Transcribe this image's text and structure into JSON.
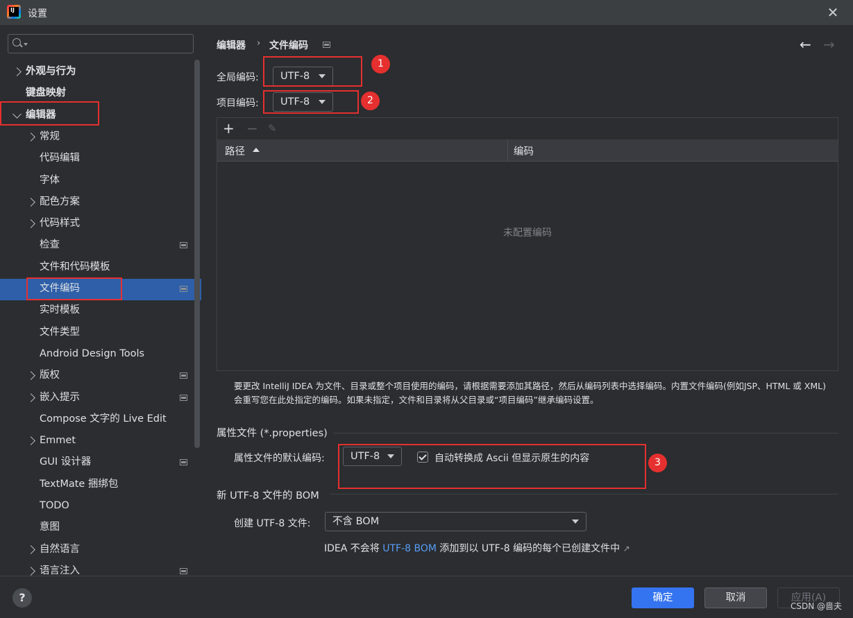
{
  "window": {
    "title": "设置"
  },
  "sidebar": {
    "items": [
      {
        "label": "外观与行为",
        "chevron": "right",
        "bold": true
      },
      {
        "label": "键盘映射",
        "chevron": "none",
        "bold": true
      },
      {
        "label": "编辑器",
        "chevron": "down",
        "bold": true
      },
      {
        "label": "常规",
        "chevron": "right"
      },
      {
        "label": "代码编辑",
        "chevron": "none"
      },
      {
        "label": "字体",
        "chevron": "none"
      },
      {
        "label": "配色方案",
        "chevron": "right"
      },
      {
        "label": "代码样式",
        "chevron": "right"
      },
      {
        "label": "检查",
        "chevron": "none",
        "project_icon": true
      },
      {
        "label": "文件和代码模板",
        "chevron": "none"
      },
      {
        "label": "文件编码",
        "chevron": "none",
        "project_icon": true,
        "selected": true
      },
      {
        "label": "实时模板",
        "chevron": "none"
      },
      {
        "label": "文件类型",
        "chevron": "none"
      },
      {
        "label": "Android Design Tools",
        "chevron": "none"
      },
      {
        "label": "版权",
        "chevron": "right",
        "project_icon": true
      },
      {
        "label": "嵌入提示",
        "chevron": "right",
        "project_icon": true
      },
      {
        "label": "Compose 文字的 Live Edit",
        "chevron": "none"
      },
      {
        "label": "Emmet",
        "chevron": "right"
      },
      {
        "label": "GUI 设计器",
        "chevron": "none",
        "project_icon": true
      },
      {
        "label": "TextMate 捆绑包",
        "chevron": "none"
      },
      {
        "label": "TODO",
        "chevron": "none"
      },
      {
        "label": "意图",
        "chevron": "none"
      },
      {
        "label": "自然语言",
        "chevron": "right"
      },
      {
        "label": "语言注入",
        "chevron": "right",
        "project_icon": true
      }
    ]
  },
  "main": {
    "breadcrumb": {
      "parent": "编辑器",
      "current": "文件编码"
    },
    "global_encoding": {
      "label": "全局编码:",
      "value": "UTF-8"
    },
    "project_encoding": {
      "label": "项目编码:",
      "value": "UTF-8"
    },
    "table": {
      "columns": [
        "路径",
        "编码"
      ],
      "empty_text": "未配置编码"
    },
    "description": "要更改 IntelliJ IDEA 为文件、目录或整个项目使用的编码，请根据需要添加其路径，然后从编码列表中选择编码。内置文件编码(例如JSP、HTML 或 XML)会重写您在此处指定的编码。如果未指定，文件和目录将从父目录或“项目编码”继承编码设置。",
    "properties_section": {
      "title": "属性文件 (*.properties)",
      "default_label": "属性文件的默认编码:",
      "default_value": "UTF-8",
      "ascii_checkbox_label": "自动转换成 Ascii 但显示原生的内容",
      "ascii_checked": true
    },
    "bom_section": {
      "title": "新 UTF-8 文件的 BOM",
      "create_label": "创建 UTF-8 文件:",
      "create_value": "不含 BOM",
      "note_prefix": "IDEA 不会将",
      "note_link": "UTF-8 BOM",
      "note_suffix": "添加到以 UTF-8 编码的每个已创建文件中"
    },
    "annotations": [
      "1",
      "2",
      "3"
    ]
  },
  "footer": {
    "help": "?",
    "ok": "确定",
    "cancel": "取消",
    "apply": "应用(A)"
  },
  "watermark": "CSDN @啬夫",
  "colors": {
    "selection": "#2e5fa8",
    "primary_button": "#3574f0",
    "annotation_red": "#e5302f",
    "link": "#589df6"
  }
}
